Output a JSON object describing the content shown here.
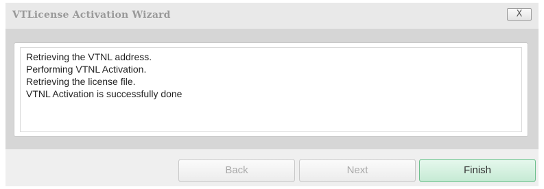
{
  "window": {
    "title": "VTLicense Activation Wizard",
    "close_label": "X"
  },
  "log": {
    "lines": [
      "Retrieving the VTNL address.",
      "Performing VTNL Activation.",
      "Retrieving the license file.",
      "VTNL Activation is successfully done"
    ]
  },
  "buttons": {
    "back": {
      "label": "Back",
      "enabled": false
    },
    "next": {
      "label": "Next",
      "enabled": false
    },
    "finish": {
      "label": "Finish",
      "enabled": true
    }
  },
  "colors": {
    "finish_accent": "#6fc08e",
    "disabled_text": "#a9a9a9",
    "title_text": "#9a9a9a"
  }
}
